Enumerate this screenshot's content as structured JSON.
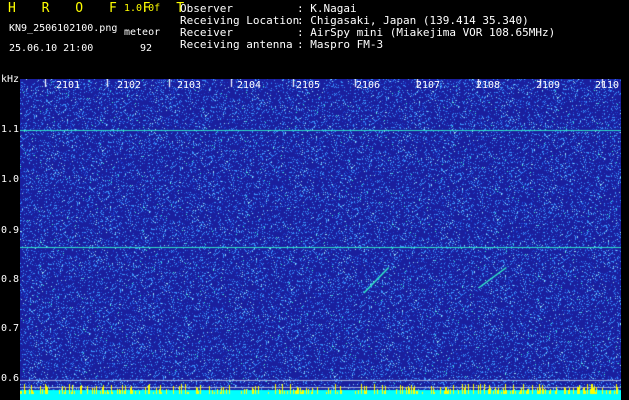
{
  "header": {
    "app_title": "H R O F F T",
    "version": "1.0.0f",
    "filename": "KN9_2506102100.png",
    "datetime": "25.06.10 21:00",
    "meteor_label": "meteor",
    "meteor_count": "92",
    "info_labels": [
      "Observer",
      "Receiving Location",
      "Receiver",
      "Receiving antenna"
    ],
    "info_values": [
      ": K.Nagai",
      ": Chigasaki, Japan (139.414 35.340)",
      ": AirSpy mini (Miakejima VOR 108.65MHz)",
      ": Maspro FM-3"
    ]
  },
  "spectrogram": {
    "y_unit": "kHz",
    "y_ticks": [
      "1.1",
      "1.0",
      "0.9",
      "0.8",
      "0.7",
      "0.6"
    ],
    "x_ticks": [
      "2101",
      "2102",
      "2103",
      "2104",
      "2105",
      "2106",
      "2107",
      "2108",
      "2109",
      "2110"
    ],
    "y_range": [
      0.57,
      1.2
    ],
    "x_range": [
      2100.6,
      2110.3
    ],
    "carrier_lines_khz": [
      1.1,
      0.87
    ],
    "colors": {
      "background": "#1a1f9e",
      "noise": "#4da0ff",
      "signal": "#33ffcc",
      "floor": "#00ffff",
      "floor_spikes": "#ffff00"
    }
  }
}
